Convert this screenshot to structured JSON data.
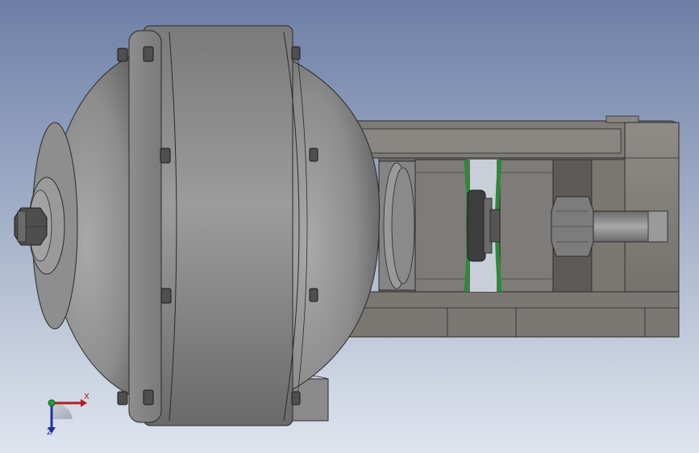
{
  "viewport": {
    "background_top": "#6d7fa6",
    "background_bottom": "#dfe5ee"
  },
  "triad": {
    "x_label": "X",
    "z_label": "Z",
    "x_color": "#b02020",
    "y_color": "#20a040",
    "z_color": "#2030a0"
  },
  "model": {
    "body_color": "#8a8a8a",
    "frame_color": "#7c7a77",
    "seal_color": "#2a8a3a",
    "fastener_color": "#5a5a5a"
  }
}
